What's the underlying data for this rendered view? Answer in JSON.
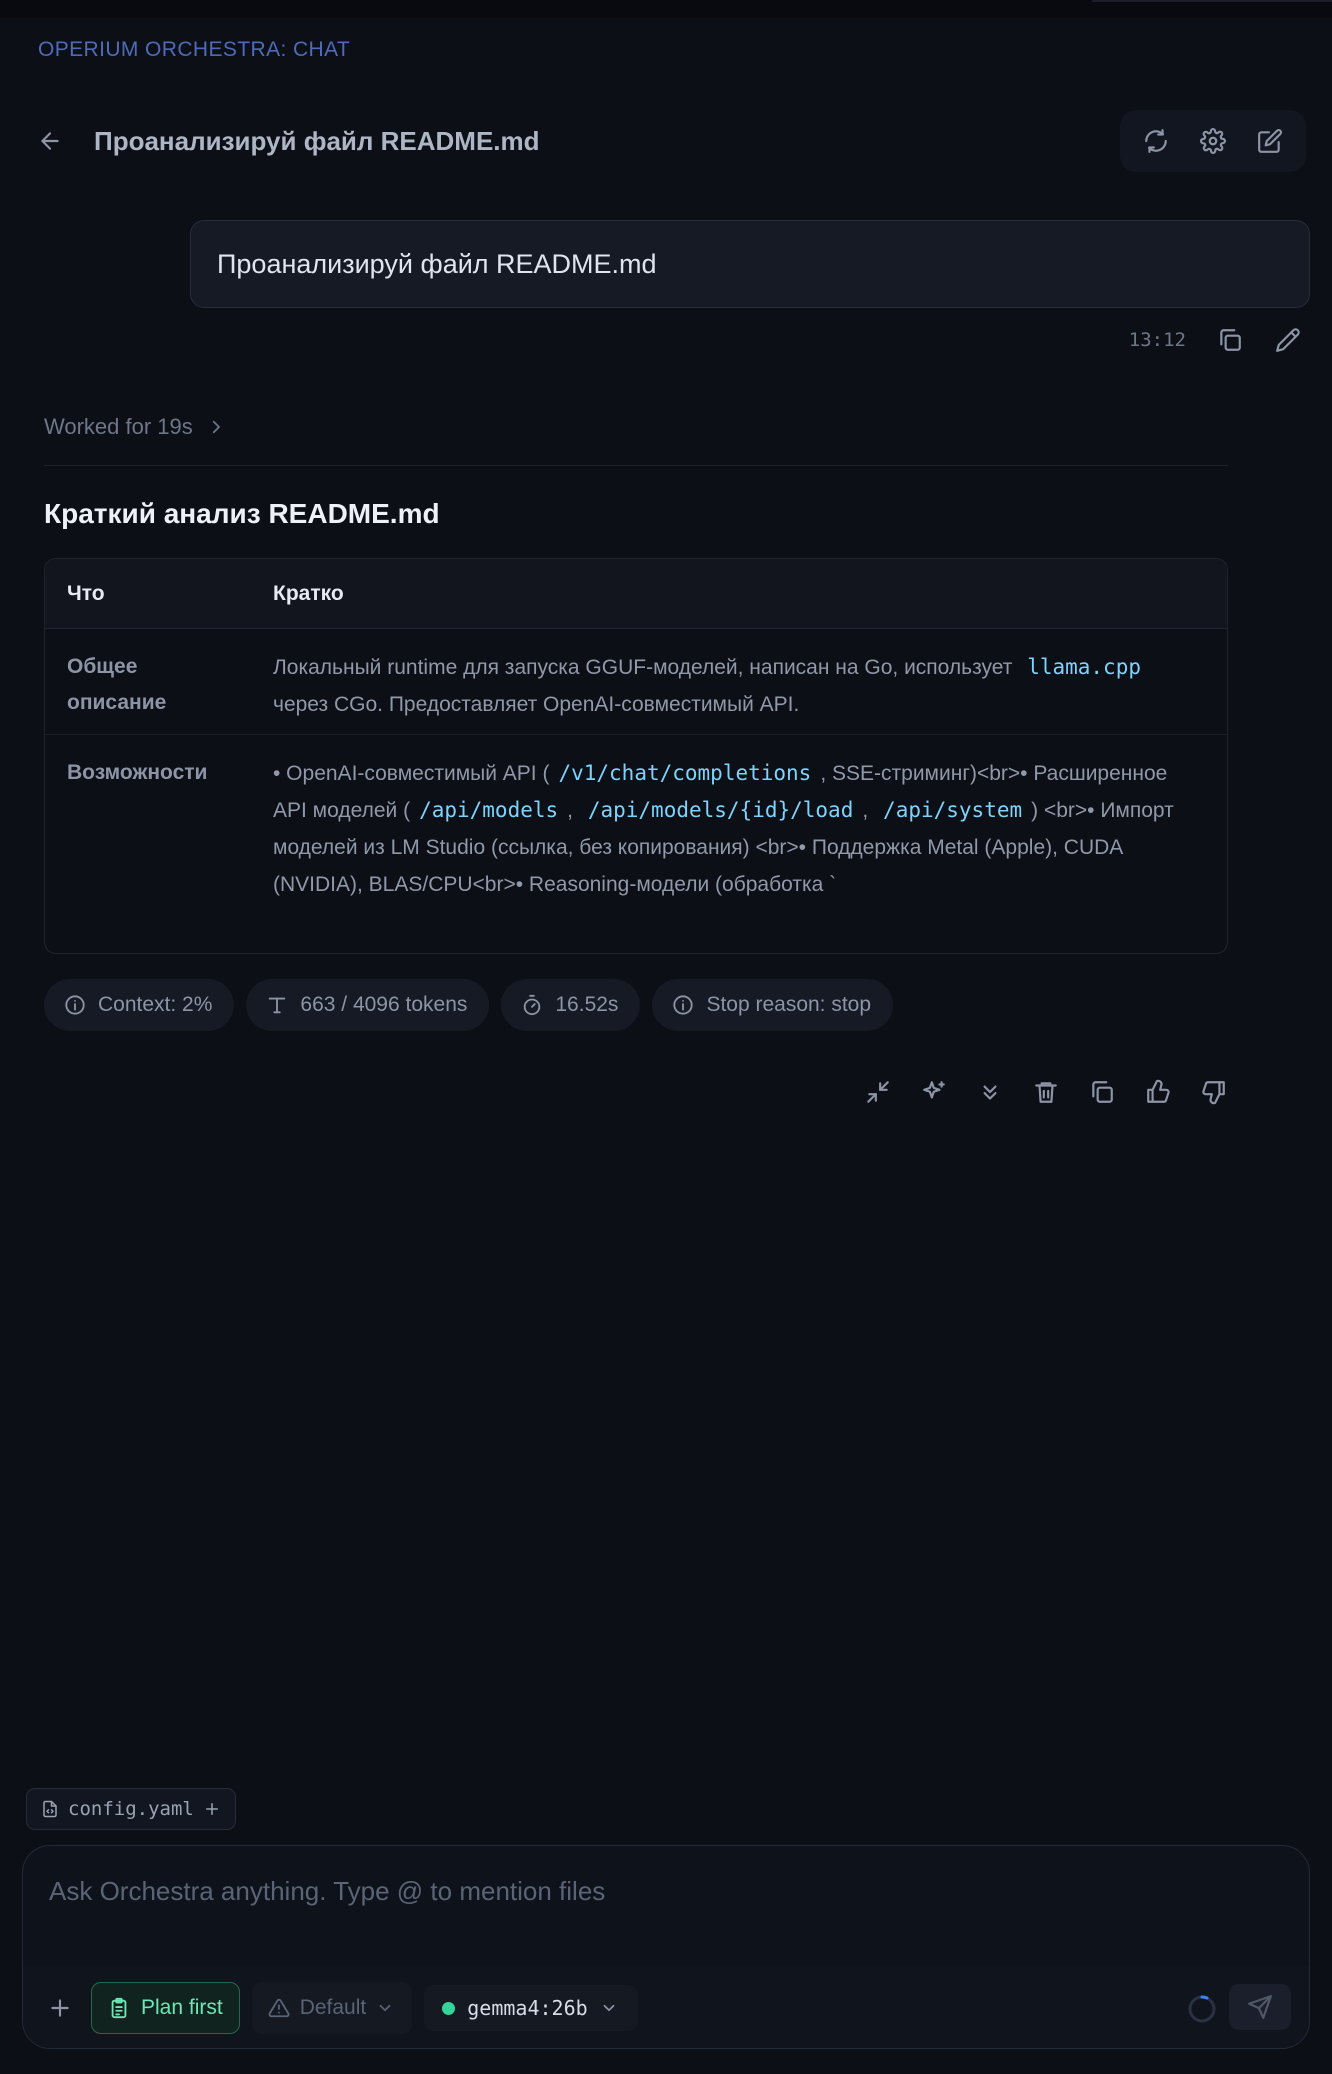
{
  "app": {
    "title": "OPERIUM ORCHESTRA: CHAT"
  },
  "header": {
    "conversation_title": "Проанализируй файл README.md"
  },
  "user_message": {
    "text": "Проанализируй файл README.md",
    "time": "13:12"
  },
  "assistant": {
    "worked_label": "Worked for 19s",
    "heading": "Краткий анализ README.md",
    "table": {
      "headers": [
        "Что",
        "Кратко"
      ],
      "rows": [
        {
          "key_line1": "Общее",
          "key_line2": "описание",
          "text1": "Локальный runtime для запуска GGUF-моделей, написан на Go, использует",
          "code1": "llama.cpp",
          "text2": "через CGo. Предоставляет OpenAI-совместимый API."
        },
        {
          "key": "Возможности",
          "text1": "• OpenAI-совместимый API (",
          "code1": "/v1/chat/completions",
          "text2": ", SSE-стриминг)<br>• Расширенное API моделей (",
          "code2": "/api/models",
          "text3": ",",
          "code3": "/api/models/{id}/load",
          "text4": ",",
          "code4": "/api/system",
          "text5": ") <br>• Импорт моделей из LM Studio (ссылка, без копирования) <br>• Поддержка Metal (Apple), CUDA (NVIDIA), BLAS/CPU<br>• Reasoning-модели (обработка `"
        }
      ]
    },
    "stats": {
      "context": "Context: 2%",
      "tokens": "663 / 4096 tokens",
      "duration": "16.52s",
      "stop_reason": "Stop reason: stop"
    }
  },
  "attachment": {
    "name": "config.yaml"
  },
  "composer": {
    "placeholder": "Ask Orchestra anything. Type @ to mention files",
    "plan_label": "Plan first",
    "mode_label": "Default",
    "model_name": "gemma4:26b"
  },
  "colors": {
    "background": "#0c0f16",
    "accent_title": "#4f6bb8",
    "code": "#7dd3fc",
    "plan_green": "#6ee7b7",
    "model_status": "#34d399"
  }
}
